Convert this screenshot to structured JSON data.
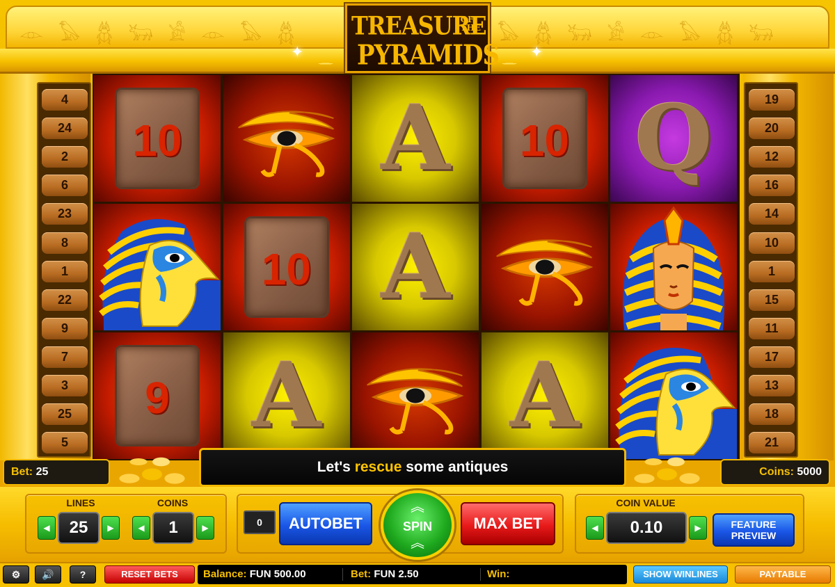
{
  "game": {
    "title_line1": "TREASURE",
    "title_of": "OF",
    "title_the": "THE",
    "title_line2": "PYRAMIDS"
  },
  "paylines": {
    "left": [
      "4",
      "24",
      "2",
      "6",
      "23",
      "8",
      "1",
      "22",
      "9",
      "7",
      "3",
      "25",
      "5"
    ],
    "right": [
      "19",
      "20",
      "12",
      "16",
      "14",
      "10",
      "1",
      "15",
      "11",
      "17",
      "13",
      "18",
      "21"
    ]
  },
  "reels": [
    [
      {
        "symbol": "10",
        "kind": "tablet",
        "bg": "red"
      },
      {
        "symbol": "horus",
        "kind": "horus",
        "bg": "red"
      },
      {
        "symbol": "9",
        "kind": "tablet",
        "bg": "red"
      }
    ],
    [
      {
        "symbol": "eye",
        "kind": "eye",
        "bg": "dred"
      },
      {
        "symbol": "10",
        "kind": "tablet",
        "bg": "red"
      },
      {
        "symbol": "A",
        "kind": "letter",
        "bg": "yel"
      }
    ],
    [
      {
        "symbol": "A",
        "kind": "letter",
        "bg": "yel"
      },
      {
        "symbol": "A",
        "kind": "letter",
        "bg": "yel"
      },
      {
        "symbol": "eye",
        "kind": "eye",
        "bg": "dred"
      }
    ],
    [
      {
        "symbol": "10",
        "kind": "tablet",
        "bg": "red"
      },
      {
        "symbol": "eye",
        "kind": "eye",
        "bg": "dred"
      },
      {
        "symbol": "A",
        "kind": "letter",
        "bg": "yel"
      }
    ],
    [
      {
        "symbol": "Q",
        "kind": "letter",
        "bg": "pur"
      },
      {
        "symbol": "pharaoh",
        "kind": "pharaoh",
        "bg": "red"
      },
      {
        "symbol": "horus",
        "kind": "horus",
        "bg": "red"
      }
    ]
  ],
  "status": {
    "bet_label": "Bet:",
    "bet_value": "25",
    "coins_label": "Coins:",
    "coins_value": "5000",
    "message_pre": "Let's ",
    "message_highlight": "rescue",
    "message_post": " some antiques"
  },
  "controls": {
    "lines_label": "LINES",
    "lines_value": "25",
    "coins_label": "COINS",
    "coins_value": "1",
    "autobet_count": "0",
    "autobet_label": "AUTOBET",
    "spin_label": "SPIN",
    "maxbet_label": "MAX BET",
    "coin_value_label": "COIN VALUE",
    "coin_value": "0.10",
    "feature_line1": "FEATURE",
    "feature_line2": "PREVIEW"
  },
  "bottom": {
    "settings_icon": "gear-icon",
    "sound_icon": "speaker-icon",
    "help_label": "?",
    "reset_label": "RESET BETS",
    "balance_label": "Balance:",
    "balance_value": "FUN 500.00",
    "bet_label": "Bet:",
    "bet_value": "FUN 2.50",
    "win_label": "Win:",
    "win_value": "",
    "show_winlines_label": "SHOW WINLINES",
    "paytable_label": "PAYTABLE"
  },
  "colors": {
    "frame_gold": "#f6c400",
    "highlight_text": "#ffc400",
    "spin_green": "#1faa1f",
    "autobet_blue": "#1a56e6",
    "maxbet_red": "#e81a1a"
  }
}
